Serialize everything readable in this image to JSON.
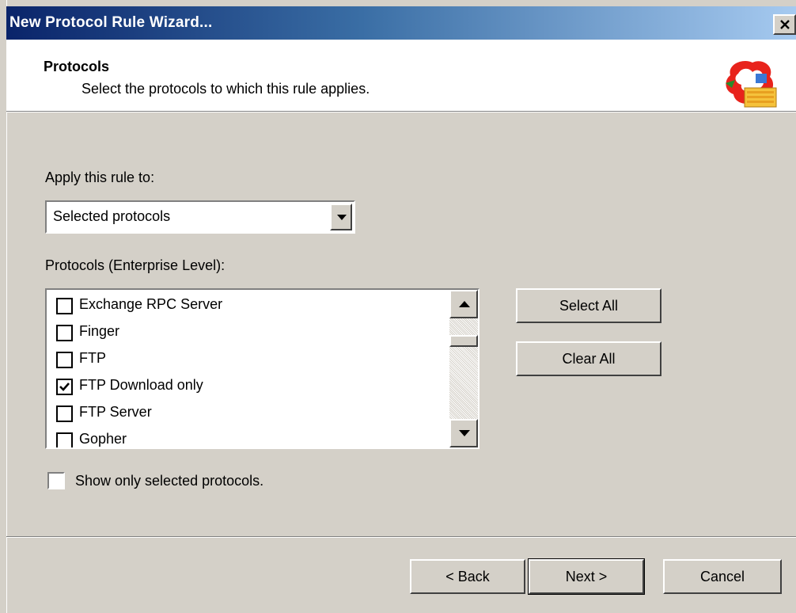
{
  "window": {
    "title": "New Protocol Rule Wizard...",
    "close_glyph": "×"
  },
  "header": {
    "title": "Protocols",
    "subtitle": "Select the protocols to which this rule applies.",
    "logo_icon": "protocol-rule-wizard-icon"
  },
  "apply": {
    "label": "Apply this rule to:",
    "selected": "Selected protocols"
  },
  "protocols": {
    "label": "Protocols (Enterprise Level):",
    "items": [
      {
        "label": "Exchange RPC Server",
        "checked": false
      },
      {
        "label": "Finger",
        "checked": false
      },
      {
        "label": "FTP",
        "checked": false
      },
      {
        "label": "FTP Download only",
        "checked": true
      },
      {
        "label": "FTP Server",
        "checked": false
      },
      {
        "label": "Gopher",
        "checked": false
      }
    ]
  },
  "buttons": {
    "select_all": "Select All",
    "clear_all": "Clear All",
    "back": "< Back",
    "next": "Next >",
    "cancel": "Cancel"
  },
  "show_only": {
    "label": "Show only selected protocols.",
    "checked": false
  },
  "colors": {
    "titlebar_start": "#0a246a",
    "titlebar_end": "#a6caf0",
    "dialog_face": "#d4d0c8",
    "logo_red": "#e8231c",
    "logo_yellow": "#f5c23b"
  }
}
